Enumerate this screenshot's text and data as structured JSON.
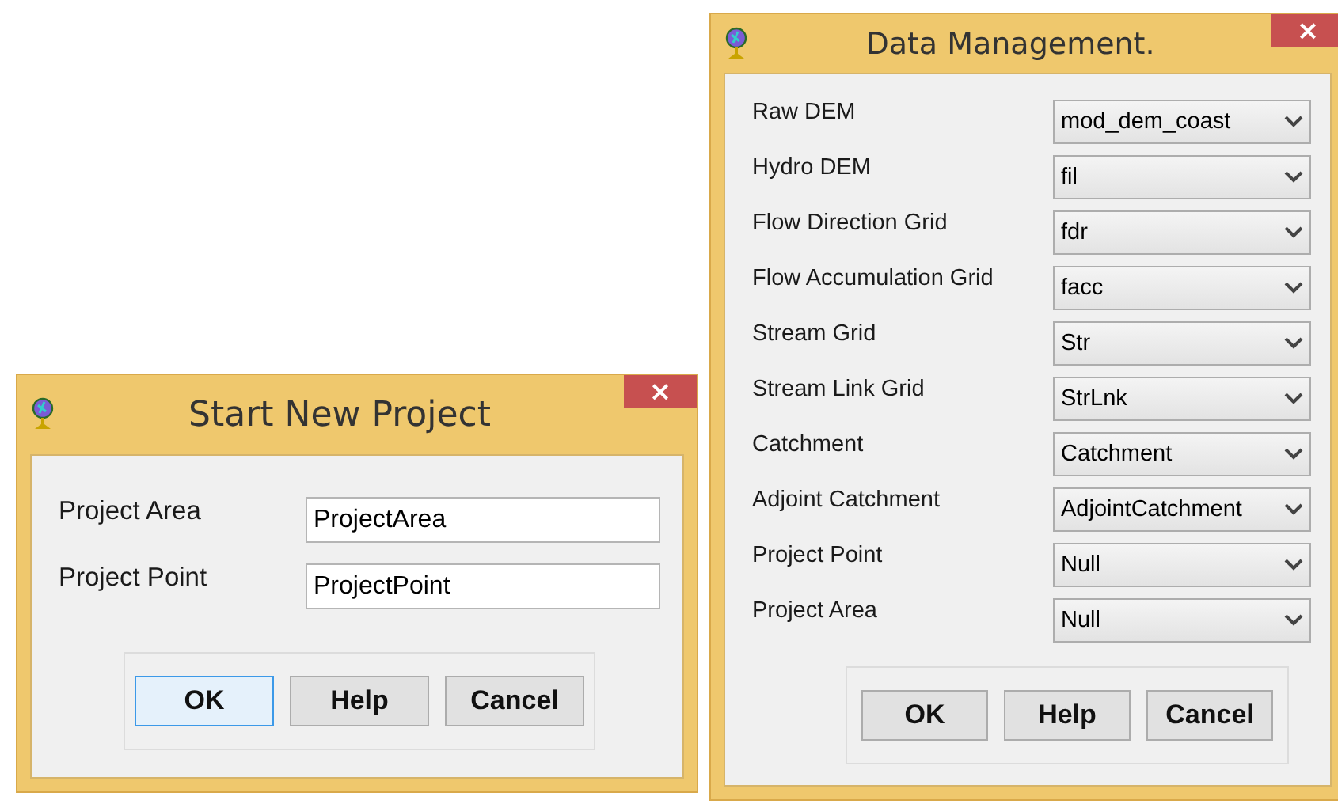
{
  "windows": [
    {
      "title": "Start New Project",
      "close": "×",
      "fields": [
        {
          "label": "Project Area",
          "kind": "text",
          "value": "ProjectArea"
        },
        {
          "label": "Project Point",
          "kind": "text",
          "value": "ProjectPoint"
        }
      ],
      "buttons": [
        {
          "label": "OK",
          "default": true
        },
        {
          "label": "Help",
          "default": false
        },
        {
          "label": "Cancel",
          "default": false
        }
      ]
    },
    {
      "title": "Data Management.",
      "close": "×",
      "fields": [
        {
          "label": "Raw DEM",
          "kind": "dropdown",
          "value": "mod_dem_coast"
        },
        {
          "label": "Hydro DEM",
          "kind": "dropdown",
          "value": "fil"
        },
        {
          "label": "Flow Direction Grid",
          "kind": "dropdown",
          "value": "fdr"
        },
        {
          "label": "Flow Accumulation Grid",
          "kind": "dropdown",
          "value": "facc"
        },
        {
          "label": "Stream Grid",
          "kind": "dropdown",
          "value": "Str"
        },
        {
          "label": "Stream Link Grid",
          "kind": "dropdown",
          "value": "StrLnk"
        },
        {
          "label": "Catchment",
          "kind": "dropdown",
          "value": "Catchment"
        },
        {
          "label": "Adjoint Catchment",
          "kind": "dropdown",
          "value": "AdjointCatchment"
        },
        {
          "label": "Project Point",
          "kind": "dropdown",
          "value": "Null"
        },
        {
          "label": "Project Area",
          "kind": "dropdown",
          "value": "Null"
        }
      ],
      "buttons": [
        {
          "label": "OK",
          "default": false
        },
        {
          "label": "Help",
          "default": false
        },
        {
          "label": "Cancel",
          "default": false
        }
      ]
    }
  ]
}
